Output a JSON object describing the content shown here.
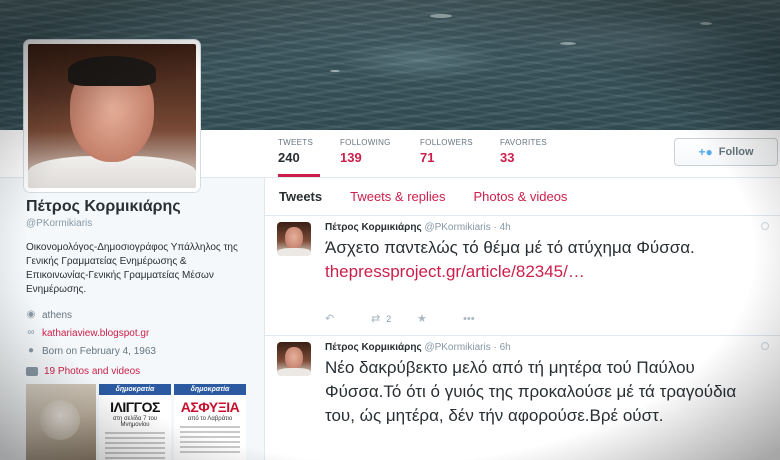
{
  "header": {
    "image": "sea-header-photo"
  },
  "profile": {
    "name": "Πέτρος Κορμικιάρης",
    "handle": "@PKormikiaris",
    "bio": "Οικονομολόγος-Δημοσιογράφος Υπάλληλος της Γενικής Γραμματείας Ενημέρωσης & Επικοινωνίας-Γενικής Γραμματείας Μέσων Ενημέρωσης.",
    "location": "athens",
    "website": "kathariaview.blogspot.gr",
    "born": "Born on February 4, 1963",
    "photos_link": "19 Photos and videos"
  },
  "stats": [
    {
      "label": "TWEETS",
      "value": "240"
    },
    {
      "label": "FOLLOWING",
      "value": "139"
    },
    {
      "label": "FOLLOWERS",
      "value": "71"
    },
    {
      "label": "FAVORITES",
      "value": "33"
    }
  ],
  "follow_button": {
    "label": "Follow",
    "icon": "add-user-icon"
  },
  "tabs": [
    {
      "label": "Tweets"
    },
    {
      "label": "Tweets & replies"
    },
    {
      "label": "Photos & videos"
    }
  ],
  "thumbnails": [
    {
      "kind": "photo"
    },
    {
      "kind": "newspaper",
      "masthead": "δημοκρατία",
      "headline": "ΙΛΙΓΓΟΣ",
      "sub": "στη σελίδα 7 του Μνημονίου"
    },
    {
      "kind": "newspaper",
      "masthead": "δημοκρατία",
      "headline": "ΑΣΦΥΞΙΑ",
      "sub": "από το Λαβράτιο"
    }
  ],
  "tweets": [
    {
      "name": "Πέτρος Κορμικιάρης",
      "handle": "@PKormikiaris",
      "time": "· 4h",
      "text": "Άσχετο παντελώς τό θέμα μέ τό ατύχημα Φύσσα.",
      "link": "thepressproject.gr/article/82345/…",
      "retweets": "2"
    },
    {
      "name": "Πέτρος Κορμικιάρης",
      "handle": "@PKormikiaris",
      "time": "· 6h",
      "text": "Νέο δακρύβεκτο μελό από τή μητέρα τού Παύλου Φύσσα.Τό ότι ό γυιός της προκαλούσε μέ τά τραγούδια του, ώς μητέρα, δέν τήν αφορούσε.Βρέ ούστ."
    }
  ],
  "colors": {
    "accent": "#cc1e4a",
    "text": "#292f33",
    "muted": "#8899a6",
    "follow_icon": "#55acee"
  }
}
